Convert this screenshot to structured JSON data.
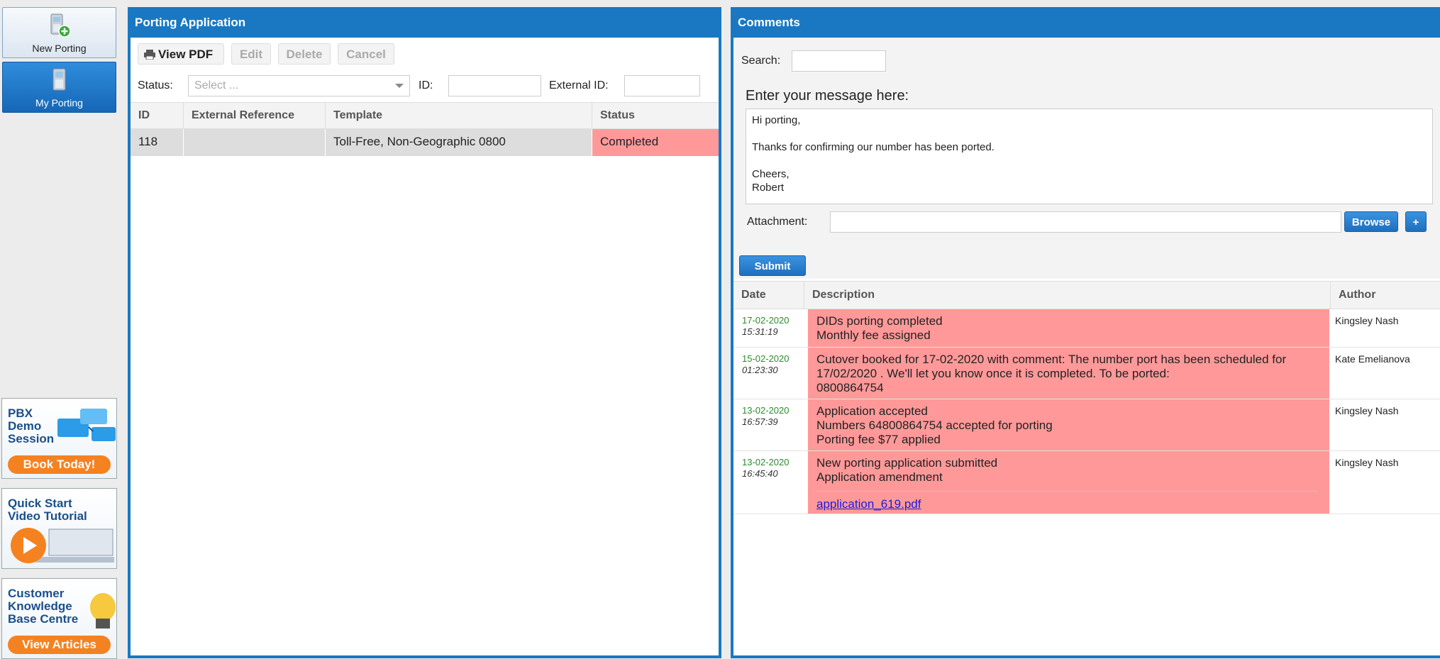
{
  "nav": {
    "new_porting": "New Porting",
    "my_porting": "My Porting",
    "promos": [
      {
        "text": "PBX\nDemo\nSession",
        "button": "Book Today!"
      },
      {
        "text": "Quick Start\nVideo Tutorial",
        "button": ""
      },
      {
        "text": "Customer\nKnowledge\nBase Centre",
        "button": "View Articles"
      }
    ]
  },
  "porting": {
    "title": "Porting Application",
    "toolbar": {
      "view_pdf": "View PDF",
      "edit": "Edit",
      "delete": "Delete",
      "cancel": "Cancel"
    },
    "filters": {
      "status_label": "Status:",
      "status_placeholder": "Select ...",
      "id_label": "ID:",
      "id_value": "",
      "external_id_label": "External ID:",
      "external_id_value": ""
    },
    "columns": [
      "ID",
      "External Reference",
      "Template",
      "Status"
    ],
    "rows": [
      {
        "id": "118",
        "external_reference": "",
        "template": "Toll-Free, Non-Geographic 0800",
        "status": "Completed"
      }
    ]
  },
  "comments": {
    "title": "Comments",
    "search_label": "Search:",
    "search_value": "",
    "message_label": "Enter your message here:",
    "message_text": "Hi porting,\n\nThanks for confirming our number has been ported.\n\nCheers,\nRobert",
    "attachment_label": "Attachment:",
    "browse": "Browse",
    "add": "+",
    "submit": "Submit",
    "columns": [
      "Date",
      "Description",
      "Author"
    ],
    "entries": [
      {
        "date": "17-02-2020",
        "time": "15:31:19",
        "lines": [
          "DIDs porting completed",
          "Monthly fee assigned"
        ],
        "author": "Kingsley Nash"
      },
      {
        "date": "15-02-2020",
        "time": "01:23:30",
        "lines": [
          "Cutover booked for 17-02-2020 with comment: The number port has been scheduled for",
          "17/02/2020 . We'll let you know once it is completed. To be ported:",
          "0800864754"
        ],
        "author": "Kate Emelianova"
      },
      {
        "date": "13-02-2020",
        "time": "16:57:39",
        "lines": [
          "Application accepted",
          "Numbers 64800864754 accepted for porting",
          "Porting fee $77 applied"
        ],
        "author": "Kingsley Nash"
      },
      {
        "date": "13-02-2020",
        "time": "16:45:40",
        "lines": [
          "New porting application submitted",
          "Application amendment"
        ],
        "link": "application_619.pdf",
        "author": "Kingsley Nash"
      }
    ]
  },
  "colors": {
    "accent": "#1a78c2",
    "status_completed": "#ff9999",
    "date_green": "#2e8b2e"
  }
}
